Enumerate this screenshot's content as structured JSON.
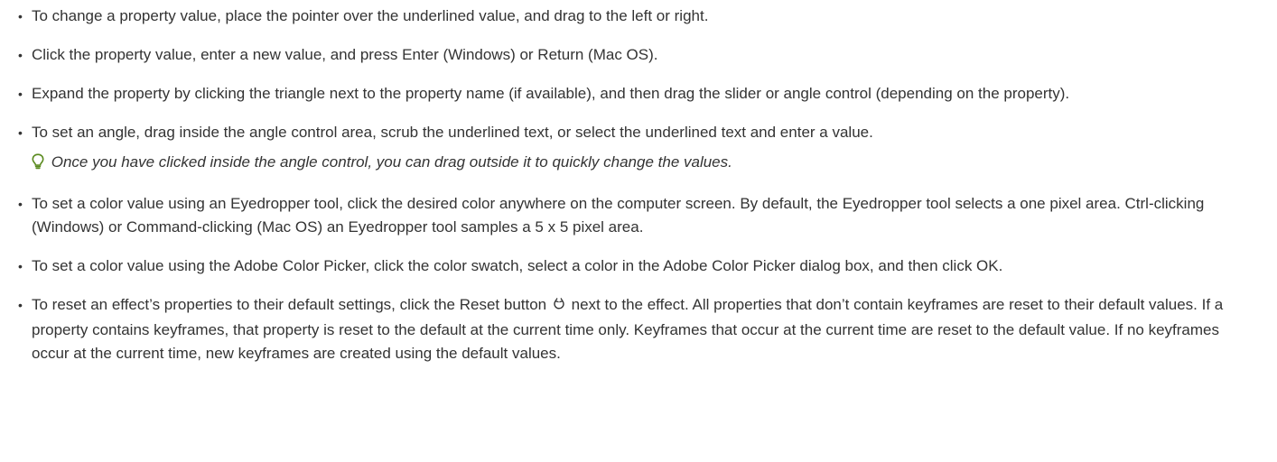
{
  "steps": [
    {
      "text": "To change a property value, place the pointer over the underlined value, and drag to the left or right."
    },
    {
      "text": "Click the property value, enter a new value, and press Enter (Windows) or Return (Mac OS)."
    },
    {
      "text": "Expand the property by clicking the triangle next to the property name (if available), and then drag the slider or angle control (depending on the property)."
    },
    {
      "text": "To set an angle, drag inside the angle control area, scrub the underlined text, or select the underlined text and enter a value."
    },
    {
      "text": "To set a color value using an Eyedropper tool, click the desired color anywhere on the computer screen. By default, the Eyedropper tool selects a one pixel area. Ctrl-clicking (Windows) or Command-clicking (Mac OS) an Eyedropper tool samples a 5 x 5 pixel area."
    },
    {
      "text": "To set a color value using the Adobe Color Picker, click the color swatch, select a color in the Adobe Color Picker dialog box, and then click OK."
    },
    {
      "text_before": "To reset an effect’s properties to their default settings, click the Reset button",
      "text_after": "next to the effect. All properties that don’t contain keyframes are reset to their default values. If a property contains keyframes, that property is reset to the default at the current time only. Keyframes that occur at the current time are reset to the default value. If no keyframes occur at the current time, new keyframes are created using the default values."
    }
  ],
  "tip": {
    "text": "Once you have clicked inside the angle control, you can drag outside it to quickly change the values.",
    "icon": "lightbulb-icon"
  },
  "bullet_char": "•",
  "colors": {
    "text": "#333333",
    "tip_icon": "#5a8a1e",
    "background": "#ffffff"
  }
}
